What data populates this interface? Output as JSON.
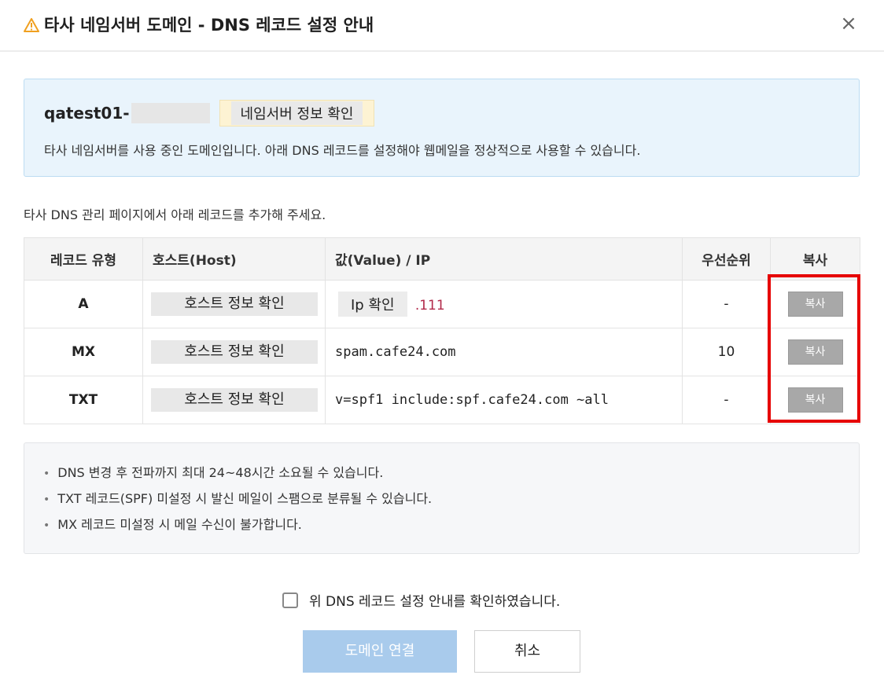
{
  "header": {
    "title": "타사 네임서버 도메인 - DNS 레코드 설정 안내",
    "warning_icon": "warning-triangle-icon",
    "close_icon": "close-icon",
    "close_label": "×"
  },
  "info": {
    "domain_name": "qatest01-",
    "nameserver_button_label": "네임서버 정보 확인",
    "description": "타사 네임서버를 사용 중인 도메인입니다. 아래 DNS 레코드를 설정해야 웹메일을 정상적으로 사용할 수 있습니다."
  },
  "section_description": "타사 DNS 관리 페이지에서 아래 레코드를 추가해 주세요.",
  "table": {
    "headers": {
      "type": "레코드 유형",
      "host": "호스트(Host)",
      "value": "값(Value) / IP",
      "priority": "우선순위",
      "copy": "복사"
    },
    "rows": [
      {
        "type": "A",
        "host": "호스트 정보 확인",
        "value_pill": "Ip 확인",
        "value_suffix": ".111",
        "priority": "-",
        "copy": "복사"
      },
      {
        "type": "MX",
        "host": "호스트 정보 확인",
        "value": "spam.cafe24.com",
        "priority": "10",
        "copy": "복사"
      },
      {
        "type": "TXT",
        "host": "호스트 정보 확인",
        "value": "v=spf1 include:spf.cafe24.com ~all",
        "priority": "-",
        "copy": "복사"
      }
    ]
  },
  "notes": [
    "DNS 변경 후 전파까지 최대 24~48시간 소요될 수 있습니다.",
    "TXT 레코드(SPF) 미설정 시 발신 메일이 스팸으로 분류될 수 있습니다.",
    "MX 레코드 미설정 시 메일 수신이 불가합니다."
  ],
  "confirm": {
    "label": "위 DNS 레코드 설정 안내를 확인하였습니다.",
    "checked": false
  },
  "buttons": {
    "connect": "도메인 연결",
    "cancel": "취소"
  },
  "colors": {
    "info_bg": "#e9f4fc",
    "highlight_border": "#e60000",
    "primary_disabled": "#a9cbec",
    "copy_button": "#a8a8a8",
    "ip_suffix": "#b22a4a",
    "warning": "#f0a020"
  }
}
